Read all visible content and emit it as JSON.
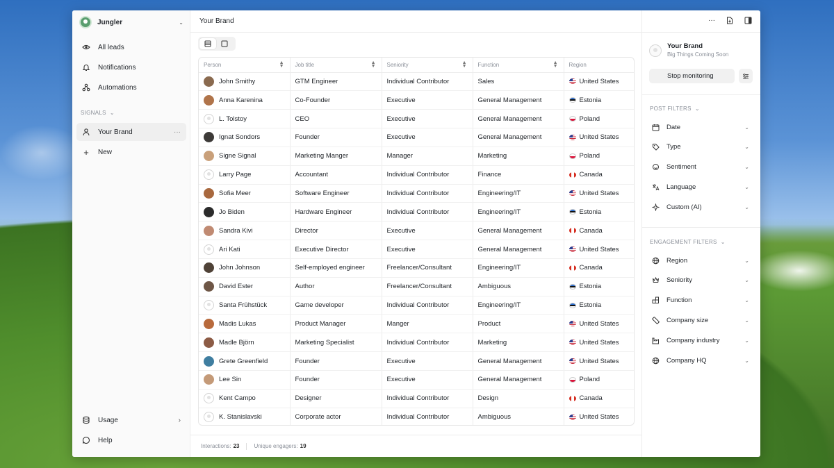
{
  "workspace": {
    "name": "Jungler"
  },
  "nav": {
    "all_leads": "All leads",
    "notifications": "Notifications",
    "automations": "Automations",
    "signals_label": "SIGNALS",
    "your_brand": "Your Brand",
    "new": "New",
    "usage": "Usage",
    "help": "Help"
  },
  "header": {
    "title": "Your Brand"
  },
  "table": {
    "columns": [
      "Person",
      "Job title",
      "Seniority",
      "Function",
      "Region"
    ],
    "rows": [
      {
        "person": "John Smithy",
        "title": "GTM Engineer",
        "seniority": "Individual Contributor",
        "function": "Sales",
        "region": "United States",
        "flag": "us",
        "avatar": "#8a6a4f"
      },
      {
        "person": "Anna Karenina",
        "title": "Co-Founder",
        "seniority": "Executive",
        "function": "General Management",
        "region": "Estonia",
        "flag": "ee",
        "avatar": "#b0744a"
      },
      {
        "person": "L. Tolstoy",
        "title": "CEO",
        "seniority": "Executive",
        "function": "General Management",
        "region": "Poland",
        "flag": "pl",
        "avatar": ""
      },
      {
        "person": "Ignat Sondors",
        "title": "Founder",
        "seniority": "Executive",
        "function": "General Management",
        "region": "United States",
        "flag": "us",
        "avatar": "#3d3a38"
      },
      {
        "person": "Signe Signal",
        "title": "Marketing Manger",
        "seniority": "Manager",
        "function": "Marketing",
        "region": "Poland",
        "flag": "pl",
        "avatar": "#c9a07a"
      },
      {
        "person": "Larry Page",
        "title": "Accountant",
        "seniority": "Individual Contributor",
        "function": "Finance",
        "region": "Canada",
        "flag": "ca",
        "avatar": ""
      },
      {
        "person": "Sofia Meer",
        "title": "Software Engineer",
        "seniority": "Individual Contributor",
        "function": "Engineering/IT",
        "region": "United States",
        "flag": "us",
        "avatar": "#a8683e"
      },
      {
        "person": "Jo Biden",
        "title": "Hardware Engineer",
        "seniority": "Individual Contributor",
        "function": "Engineering/IT",
        "region": "Estonia",
        "flag": "ee",
        "avatar": "#2b2b2b"
      },
      {
        "person": "Sandra Kivi",
        "title": "Director",
        "seniority": "Executive",
        "function": "General Management",
        "region": "Canada",
        "flag": "ca",
        "avatar": "#c08a72"
      },
      {
        "person": "Ari Kati",
        "title": "Executive Director",
        "seniority": "Executive",
        "function": "General Management",
        "region": "United States",
        "flag": "us",
        "avatar": ""
      },
      {
        "person": "John Johnson",
        "title": "Self-employed engineer",
        "seniority": "Freelancer/Consultant",
        "function": "Engineering/IT",
        "region": "Canada",
        "flag": "ca",
        "avatar": "#4f4237"
      },
      {
        "person": "David Ester",
        "title": "Author",
        "seniority": "Freelancer/Consultant",
        "function": "Ambiguous",
        "region": "Estonia",
        "flag": "ee",
        "avatar": "#6e5646"
      },
      {
        "person": "Santa Frühstück",
        "title": "Game developer",
        "seniority": "Individual Contributor",
        "function": "Engineering/IT",
        "region": "Estonia",
        "flag": "ee",
        "avatar": ""
      },
      {
        "person": "Madis Lukas",
        "title": "Product Manager",
        "seniority": "Manger",
        "function": "Product",
        "region": "United States",
        "flag": "us",
        "avatar": "#b86a3c"
      },
      {
        "person": "Madle Björn",
        "title": "Marketing Specialist",
        "seniority": "Individual Contributor",
        "function": "Marketing",
        "region": "United States",
        "flag": "us",
        "avatar": "#8c5b45"
      },
      {
        "person": "Grete Greenfield",
        "title": "Founder",
        "seniority": "Executive",
        "function": "General Management",
        "region": "United States",
        "flag": "us",
        "avatar": "#3f7ea0"
      },
      {
        "person": "Lee Sin",
        "title": "Founder",
        "seniority": "Executive",
        "function": "General Management",
        "region": "Poland",
        "flag": "pl",
        "avatar": "#c49a78"
      },
      {
        "person": "Kent Campo",
        "title": "Designer",
        "seniority": "Individual Contributor",
        "function": "Design",
        "region": "Canada",
        "flag": "ca",
        "avatar": ""
      },
      {
        "person": "K. Stanislavski",
        "title": "Corporate actor",
        "seniority": "Individual Contributor",
        "function": "Ambiguous",
        "region": "United States",
        "flag": "us",
        "avatar": ""
      }
    ]
  },
  "footer": {
    "interactions_label": "Interactions:",
    "interactions_value": "23",
    "engagers_label": "Unique engagers:",
    "engagers_value": "19"
  },
  "panel": {
    "name": "Your Brand",
    "subtitle": "Big Things Coming Soon",
    "stop_label": "Stop monitoring",
    "post_filters_label": "POST FILTERS",
    "post_filters": [
      {
        "label": "Date",
        "icon": "calendar-icon"
      },
      {
        "label": "Type",
        "icon": "tag-icon"
      },
      {
        "label": "Sentiment",
        "icon": "sentiment-icon"
      },
      {
        "label": "Language",
        "icon": "language-icon"
      },
      {
        "label": "Custom (AI)",
        "icon": "sparkle-icon"
      }
    ],
    "engagement_filters_label": "ENGAGEMENT FILTERS",
    "engagement_filters": [
      {
        "label": "Region",
        "icon": "globe-icon"
      },
      {
        "label": "Seniority",
        "icon": "crown-icon"
      },
      {
        "label": "Function",
        "icon": "blocks-icon"
      },
      {
        "label": "Company size",
        "icon": "ruler-icon"
      },
      {
        "label": "Company industry",
        "icon": "factory-icon"
      },
      {
        "label": "Company HQ",
        "icon": "globe-icon"
      }
    ]
  }
}
